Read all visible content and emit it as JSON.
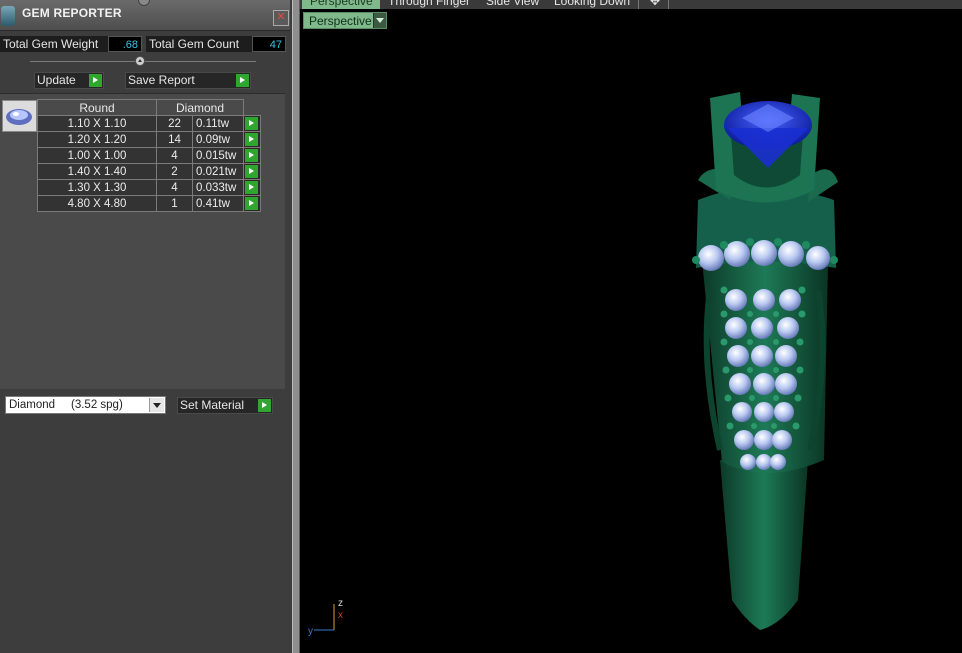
{
  "panel": {
    "title": "GEM REPORTER",
    "close_glyph": "✕",
    "total_weight_label": "Total Gem Weight",
    "total_weight_value": ".68",
    "total_count_label": "Total Gem Count",
    "total_count_value": "47",
    "update_label": "Update",
    "save_report_label": "Save Report",
    "table_header": {
      "shape": "Round",
      "material": "Diamond"
    },
    "rows": [
      {
        "size": "1.10 X 1.10",
        "count": "22",
        "weight": "0.11tw"
      },
      {
        "size": "1.20 X 1.20",
        "count": "14",
        "weight": "0.09tw"
      },
      {
        "size": "1.00 X 1.00",
        "count": "4",
        "weight": "0.015tw"
      },
      {
        "size": "1.40 X 1.40",
        "count": "2",
        "weight": "0.021tw"
      },
      {
        "size": "1.30 X 1.30",
        "count": "4",
        "weight": "0.033tw"
      },
      {
        "size": "4.80 X 4.80",
        "count": "1",
        "weight": "0.41tw"
      }
    ],
    "material_select_value": "Diamond     (3.52 spg)",
    "set_material_label": "Set Material"
  },
  "viewport": {
    "tabs": [
      "Perspective",
      "Through Finger",
      "Side View",
      "Looking Down"
    ],
    "add_tab_glyph": "✥",
    "view_dropdown": "Perspective",
    "axis_labels": {
      "z": "z",
      "y": "y",
      "x": "x"
    }
  },
  "colors": {
    "ring_metal": "#1a6b4d",
    "center_stone": "#1a2fd0",
    "accent_green": "#2fa62f",
    "tab_active": "#7fb88a",
    "value_text": "#37c5e6"
  }
}
